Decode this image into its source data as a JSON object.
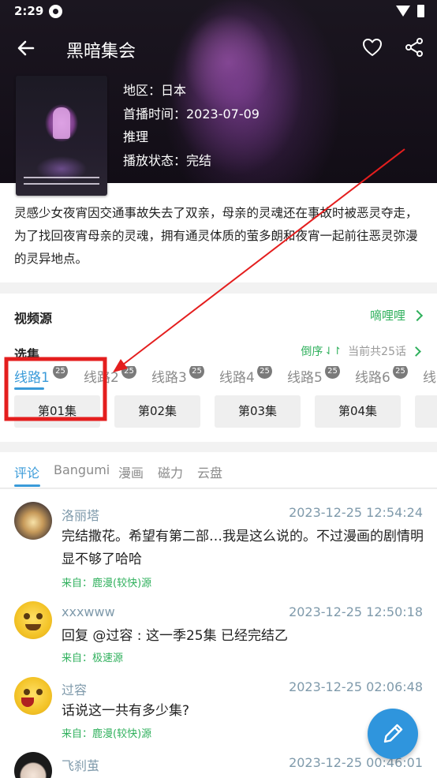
{
  "status_bar": {
    "time": "2:29"
  },
  "header": {
    "title": "黑暗集会"
  },
  "info": {
    "region": "地区：日本",
    "premiere": "首播时间：2023-07-09",
    "genre": "推理",
    "play_status": "播放状态：完结"
  },
  "description": "灵感少女夜宵因交通事故失去了双亲，母亲的灵魂还在事故时被恶灵夺走，为了找回夜宵母亲的灵魂，拥有通灵体质的萤多朗和夜宵一起前往恶灵弥漫的灵异地点。",
  "source": {
    "label": "视频源",
    "value": "嘀哩哩"
  },
  "episodes": {
    "label": "选集",
    "order": "倒序",
    "total": "当前共25话",
    "lines": [
      {
        "label": "线路1",
        "count": "25"
      },
      {
        "label": "线路2",
        "count": "25"
      },
      {
        "label": "线路3",
        "count": "25"
      },
      {
        "label": "线路4",
        "count": "25"
      },
      {
        "label": "线路5",
        "count": "25"
      },
      {
        "label": "线路6",
        "count": "25"
      },
      {
        "label": "线"
      }
    ],
    "items": [
      "第01集",
      "第02集",
      "第03集",
      "第04集"
    ]
  },
  "comment_tabs": [
    "评论",
    "Bangumi",
    "漫画",
    "磁力",
    "云盘"
  ],
  "comments": [
    {
      "user": "洛丽塔",
      "time": "2023-12-25 12:54:24",
      "text": "完结撒花。希望有第二部…我是这么说的。不过漫画的剧情明显不够了哈哈",
      "from": "来自：鹿漫(较快)源"
    },
    {
      "user": "xxxwww",
      "time": "2023-12-25 12:50:18",
      "text": "回复 @过容 : 这一季25集 已经完结乙",
      "from": "来自：极速源"
    },
    {
      "user": "过容",
      "time": "2023-12-25 02:06:48",
      "text": "话说这一共有多少集?",
      "from": "来自：鹿漫(较快)源"
    },
    {
      "user": "飞刹茧",
      "time": "2023-12-25 00:46:01"
    }
  ],
  "colors": {
    "accent_blue": "#3a9bd9",
    "green": "#2fb05c",
    "annotation_red": "#e41e1e"
  }
}
